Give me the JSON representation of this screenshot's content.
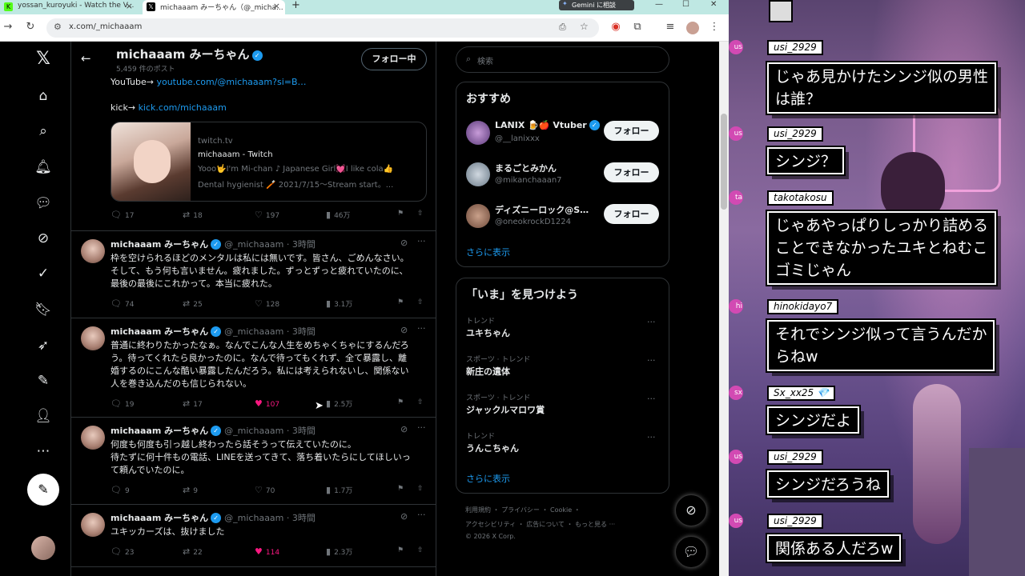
{
  "browser": {
    "tabs": [
      {
        "title": "yossan_kuroyuki - Watch the V...",
        "icon": "kick-icon",
        "active": false
      },
      {
        "title": "michaaam みーちゃん（@_micha...",
        "icon": "x-icon",
        "active": true
      }
    ],
    "new_tab": "+",
    "gemini_label": "Gemini に相談",
    "url": "x.com/_michaaam"
  },
  "profile": {
    "name": "michaaam みーちゃん",
    "post_count": "5,459 件のポスト",
    "follow_label": "フォロー中",
    "bio_youtube_prefix": "YouTube→ ",
    "bio_youtube_link": "youtube.com/@michaaam?si=B…",
    "bio_kick_prefix": "kick→ ",
    "bio_kick_link": "kick.com/michaaam",
    "card": {
      "domain": "twitch.tv",
      "title": "michaaam - Twitch",
      "desc1": "Yooo🤟I'm Mi-chan ♪ Japanese Girl💓I like cola👍",
      "desc2": "Dental hygienist 🪥 2021/7/15～Stream start。..."
    },
    "pinned_actions": {
      "replies": "17",
      "reposts": "18",
      "likes": "197",
      "views": "46万"
    }
  },
  "tweets": [
    {
      "name": "michaaam みーちゃん",
      "meta": "@_michaaam · 3時間",
      "lines": [
        "枠を空けられるほどのメンタルは私には無いです。皆さん、ごめんなさい。",
        "そして、もう何も言いません。疲れました。ずっとずっと疲れていたのに、",
        "最後の最後にこれかって。本当に疲れた。"
      ],
      "replies": "74",
      "reposts": "25",
      "likes": "128",
      "views": "3.1万",
      "liked": false
    },
    {
      "name": "michaaam みーちゃん",
      "meta": "@_michaaam · 3時間",
      "lines": [
        "普通に終わりたかったなぁ。なんでこんな人生をめちゃくちゃにするんだろ",
        "う。待ってくれたら良かったのに。なんで待ってもくれず、全て暴露し、離",
        "婚するのにこんな酷い暴露したんだろう。私には考えられないし、関係ない",
        "人を巻き込んだのも信じられない。"
      ],
      "replies": "19",
      "reposts": "17",
      "likes": "107",
      "views": "2.5万",
      "liked": true
    },
    {
      "name": "michaaam みーちゃん",
      "meta": "@_michaaam · 3時間",
      "lines": [
        "何度も何度も引っ越し終わったら話そうって伝えていたのに。",
        "待たずに何十件もの電話、LINEを送ってきて、落ち着いたらにしてほしいっ",
        "て頼んでいたのに。"
      ],
      "replies": "9",
      "reposts": "9",
      "likes": "70",
      "views": "1.7万",
      "liked": false
    },
    {
      "name": "michaaam みーちゃん",
      "meta": "@_michaaam · 3時間",
      "lines": [
        "ユキッカーズは、抜けました"
      ],
      "replies": "23",
      "reposts": "22",
      "likes": "114",
      "views": "2.3万",
      "liked": true
    }
  ],
  "sidebar": {
    "search_placeholder": "検索",
    "recommend_title": "おすすめ",
    "suggestions": [
      {
        "name": "LANIX 🍺🍎 Vtuber",
        "handle": "@__lanixxx",
        "button": "フォロー"
      },
      {
        "name": "まるごとみかん",
        "handle": "@mikanchaaan7",
        "button": "フォロー"
      },
      {
        "name": "ディズニーロック@S…",
        "handle": "@oneokrockD1224",
        "button": "フォロー"
      }
    ],
    "show_more": "さらに表示",
    "trends_title": "「いま」を見つけよう",
    "trends": [
      {
        "category": "トレンド",
        "name": "ユキちゃん"
      },
      {
        "category": "スポーツ · トレンド",
        "name": "新庄の遺体"
      },
      {
        "category": "スポーツ · トレンド",
        "name": "ジャックルマロワ賞"
      },
      {
        "category": "トレンド",
        "name": "うんこちゃん"
      }
    ],
    "trends_show_more": "さらに表示",
    "footer_line1": "利用規約 ・ プライバシー ・ Cookie ・",
    "footer_line2": "アクセシビリティ ・ 広告について ・ もっと見る ···",
    "footer_line3": "© 2026 X Corp."
  },
  "stream_chat": [
    {
      "user": "usi_2929",
      "lines": [
        "じゃあ見かけたシンジ似の男性",
        "は誰？"
      ],
      "dot": "us"
    },
    {
      "user": "usi_2929",
      "lines": [
        "シンジ？"
      ],
      "dot": "us"
    },
    {
      "user": "takotakosu",
      "lines": [
        "じゃあやっぱりしっかり詰める",
        "ことできなかったユキとねむこ",
        "ゴミじゃん"
      ],
      "dot": "ta"
    },
    {
      "user": "hinokidayo7",
      "lines": [
        "それでシンジ似って言うんだか",
        "らねw"
      ],
      "dot": "hi"
    },
    {
      "user": "Sx_xx25 💎",
      "lines": [
        "シンジだよ"
      ],
      "dot": "sx"
    },
    {
      "user": "usi_2929",
      "lines": [
        "シンジだろうね"
      ],
      "dot": "us"
    },
    {
      "user": "usi_2929",
      "lines": [
        "関係ある人だろw"
      ],
      "dot": "us"
    }
  ],
  "colors": {
    "accent": "#1d9bf0",
    "like": "#f91880",
    "x_bg": "#000000",
    "chat_dot": "#d24ab3"
  }
}
